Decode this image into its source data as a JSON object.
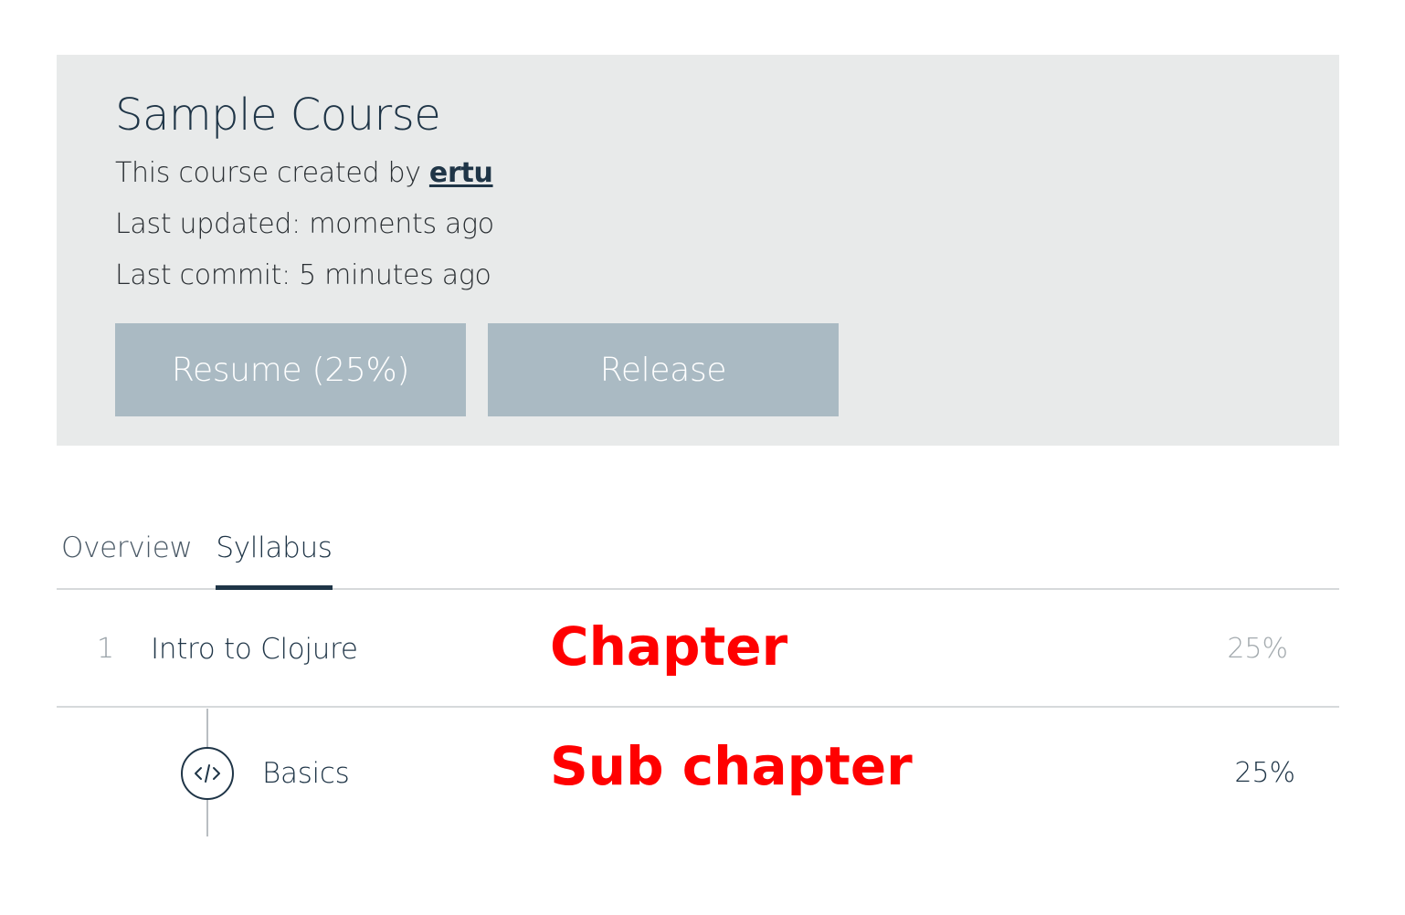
{
  "course": {
    "title": "Sample Course",
    "created_prefix": "This course created by ",
    "author": "ertu",
    "last_updated": "Last updated: moments ago",
    "last_commit": "Last commit: 5 minutes ago",
    "resume_label": "Resume (25%)",
    "release_label": "Release"
  },
  "tabs": {
    "overview": "Overview",
    "syllabus": "Syllabus",
    "active": "Syllabus"
  },
  "syllabus": {
    "chapter": {
      "number": "1",
      "title": "Intro to Clojure",
      "progress": "25%",
      "annotation": "Chapter"
    },
    "sub_chapter": {
      "icon": "code-icon",
      "title": "Basics",
      "progress": "25%",
      "annotation": "Sub chapter"
    }
  },
  "colors": {
    "primary": "#1f3547",
    "header_bg": "#e8eaea",
    "button_bg": "#aabac3",
    "annotation": "#ff0000",
    "muted": "#a3aaae"
  }
}
